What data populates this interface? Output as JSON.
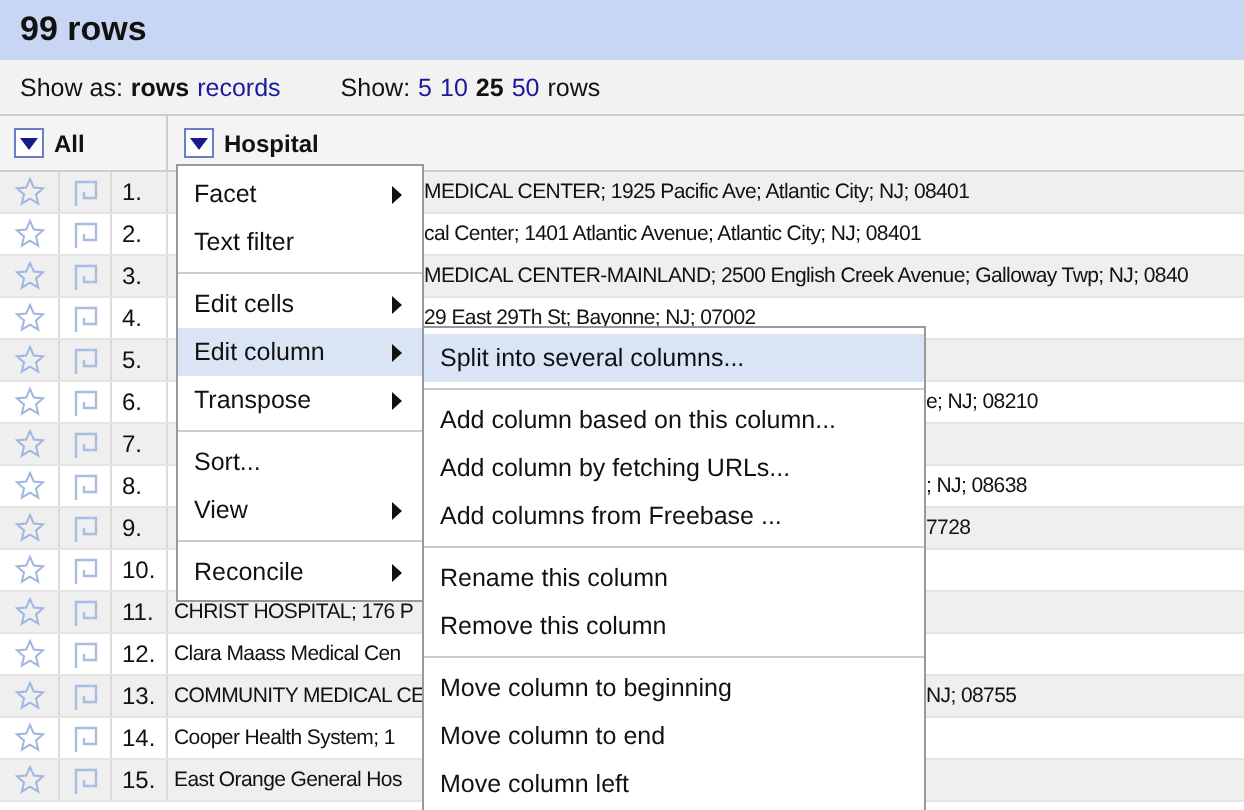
{
  "title": "99 rows",
  "controls": {
    "show_as_label": "Show as:",
    "show_as_options": [
      {
        "label": "rows",
        "selected": true
      },
      {
        "label": "records",
        "selected": false
      }
    ],
    "show_label": "Show:",
    "page_sizes": [
      {
        "label": "5",
        "selected": false
      },
      {
        "label": "10",
        "selected": false
      },
      {
        "label": "25",
        "selected": true
      },
      {
        "label": "50",
        "selected": false
      }
    ],
    "show_suffix": "rows"
  },
  "table": {
    "columns": [
      "All",
      "Hospital"
    ],
    "rows": [
      {
        "number": "1.",
        "hospital_visible": [
          {
            "kind": "mid",
            "text": "MEDICAL CENTER; 1925 Pacific Ave; Atlantic City; NJ; 08401"
          }
        ]
      },
      {
        "number": "2.",
        "hospital_visible": [
          {
            "kind": "mid",
            "text": "cal Center; 1401 Atlantic Avenue; Atlantic City; NJ; 08401"
          }
        ]
      },
      {
        "number": "3.",
        "hospital_visible": [
          {
            "kind": "mid",
            "text": "MEDICAL CENTER-MAINLAND; 2500 English Creek Avenue; Galloway Twp; NJ; 0840"
          }
        ]
      },
      {
        "number": "4.",
        "hospital_visible": [
          {
            "kind": "mid",
            "text": "29 East 29Th St; Bayonne; NJ; 07002"
          }
        ]
      },
      {
        "number": "5.",
        "hospital_visible": []
      },
      {
        "number": "6.",
        "hospital_visible": [
          {
            "kind": "tail",
            "text": "e; NJ; 08210"
          }
        ]
      },
      {
        "number": "7.",
        "hospital_visible": []
      },
      {
        "number": "8.",
        "hospital_visible": [
          {
            "kind": "tail",
            "text": "; NJ; 08638"
          }
        ]
      },
      {
        "number": "9.",
        "hospital_visible": [
          {
            "kind": "tail",
            "text": "7728"
          }
        ]
      },
      {
        "number": "10.",
        "hospital_visible": []
      },
      {
        "number": "11.",
        "hospital_visible": [
          {
            "kind": "lead",
            "text": "CHRIST HOSPITAL; 176 P"
          }
        ]
      },
      {
        "number": "12.",
        "hospital_visible": [
          {
            "kind": "lead",
            "text": "Clara Maass Medical Cen"
          }
        ]
      },
      {
        "number": "13.",
        "hospital_visible": [
          {
            "kind": "lead",
            "text": "COMMUNITY MEDICAL CE"
          },
          {
            "kind": "tail",
            "text": "NJ; 08755"
          }
        ]
      },
      {
        "number": "14.",
        "hospital_visible": [
          {
            "kind": "lead",
            "text": "Cooper Health System; 1"
          }
        ]
      },
      {
        "number": "15.",
        "hospital_visible": [
          {
            "kind": "lead",
            "text": "East Orange General Hos"
          }
        ]
      }
    ]
  },
  "column_menu": {
    "groups": [
      [
        {
          "label": "Facet",
          "submenu": true,
          "selected": false
        },
        {
          "label": "Text filter",
          "submenu": false,
          "selected": false
        }
      ],
      [
        {
          "label": "Edit cells",
          "submenu": true,
          "selected": false
        },
        {
          "label": "Edit column",
          "submenu": true,
          "selected": true
        },
        {
          "label": "Transpose",
          "submenu": true,
          "selected": false
        }
      ],
      [
        {
          "label": "Sort...",
          "submenu": false,
          "selected": false
        },
        {
          "label": "View",
          "submenu": true,
          "selected": false
        }
      ],
      [
        {
          "label": "Reconcile",
          "submenu": true,
          "selected": false
        }
      ]
    ]
  },
  "edit_column_submenu": {
    "groups": [
      [
        {
          "label": "Split into several columns...",
          "selected": true
        }
      ],
      [
        {
          "label": "Add column based on this column...",
          "selected": false
        },
        {
          "label": "Add column by fetching URLs...",
          "selected": false
        },
        {
          "label": "Add columns from Freebase ...",
          "selected": false
        }
      ],
      [
        {
          "label": "Rename this column",
          "selected": false
        },
        {
          "label": "Remove this column",
          "selected": false
        }
      ],
      [
        {
          "label": "Move column to beginning",
          "selected": false
        },
        {
          "label": "Move column to end",
          "selected": false
        },
        {
          "label": "Move column left",
          "selected": false
        }
      ]
    ]
  }
}
